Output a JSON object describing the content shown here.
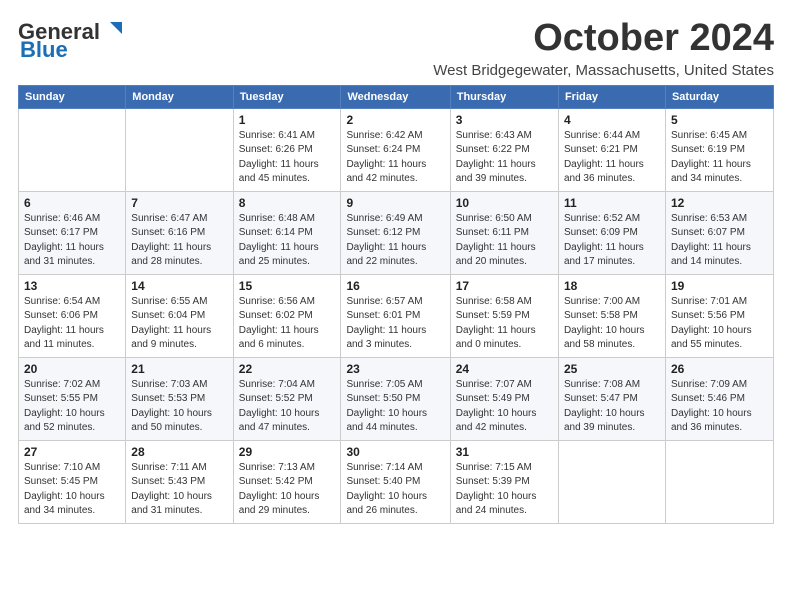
{
  "logo": {
    "general": "General",
    "blue": "Blue"
  },
  "title": "October 2024",
  "location": "West Bridgegewater, Massachusetts, United States",
  "days_of_week": [
    "Sunday",
    "Monday",
    "Tuesday",
    "Wednesday",
    "Thursday",
    "Friday",
    "Saturday"
  ],
  "weeks": [
    [
      {
        "day": "",
        "info": ""
      },
      {
        "day": "",
        "info": ""
      },
      {
        "day": "1",
        "info": "Sunrise: 6:41 AM\nSunset: 6:26 PM\nDaylight: 11 hours and 45 minutes."
      },
      {
        "day": "2",
        "info": "Sunrise: 6:42 AM\nSunset: 6:24 PM\nDaylight: 11 hours and 42 minutes."
      },
      {
        "day": "3",
        "info": "Sunrise: 6:43 AM\nSunset: 6:22 PM\nDaylight: 11 hours and 39 minutes."
      },
      {
        "day": "4",
        "info": "Sunrise: 6:44 AM\nSunset: 6:21 PM\nDaylight: 11 hours and 36 minutes."
      },
      {
        "day": "5",
        "info": "Sunrise: 6:45 AM\nSunset: 6:19 PM\nDaylight: 11 hours and 34 minutes."
      }
    ],
    [
      {
        "day": "6",
        "info": "Sunrise: 6:46 AM\nSunset: 6:17 PM\nDaylight: 11 hours and 31 minutes."
      },
      {
        "day": "7",
        "info": "Sunrise: 6:47 AM\nSunset: 6:16 PM\nDaylight: 11 hours and 28 minutes."
      },
      {
        "day": "8",
        "info": "Sunrise: 6:48 AM\nSunset: 6:14 PM\nDaylight: 11 hours and 25 minutes."
      },
      {
        "day": "9",
        "info": "Sunrise: 6:49 AM\nSunset: 6:12 PM\nDaylight: 11 hours and 22 minutes."
      },
      {
        "day": "10",
        "info": "Sunrise: 6:50 AM\nSunset: 6:11 PM\nDaylight: 11 hours and 20 minutes."
      },
      {
        "day": "11",
        "info": "Sunrise: 6:52 AM\nSunset: 6:09 PM\nDaylight: 11 hours and 17 minutes."
      },
      {
        "day": "12",
        "info": "Sunrise: 6:53 AM\nSunset: 6:07 PM\nDaylight: 11 hours and 14 minutes."
      }
    ],
    [
      {
        "day": "13",
        "info": "Sunrise: 6:54 AM\nSunset: 6:06 PM\nDaylight: 11 hours and 11 minutes."
      },
      {
        "day": "14",
        "info": "Sunrise: 6:55 AM\nSunset: 6:04 PM\nDaylight: 11 hours and 9 minutes."
      },
      {
        "day": "15",
        "info": "Sunrise: 6:56 AM\nSunset: 6:02 PM\nDaylight: 11 hours and 6 minutes."
      },
      {
        "day": "16",
        "info": "Sunrise: 6:57 AM\nSunset: 6:01 PM\nDaylight: 11 hours and 3 minutes."
      },
      {
        "day": "17",
        "info": "Sunrise: 6:58 AM\nSunset: 5:59 PM\nDaylight: 11 hours and 0 minutes."
      },
      {
        "day": "18",
        "info": "Sunrise: 7:00 AM\nSunset: 5:58 PM\nDaylight: 10 hours and 58 minutes."
      },
      {
        "day": "19",
        "info": "Sunrise: 7:01 AM\nSunset: 5:56 PM\nDaylight: 10 hours and 55 minutes."
      }
    ],
    [
      {
        "day": "20",
        "info": "Sunrise: 7:02 AM\nSunset: 5:55 PM\nDaylight: 10 hours and 52 minutes."
      },
      {
        "day": "21",
        "info": "Sunrise: 7:03 AM\nSunset: 5:53 PM\nDaylight: 10 hours and 50 minutes."
      },
      {
        "day": "22",
        "info": "Sunrise: 7:04 AM\nSunset: 5:52 PM\nDaylight: 10 hours and 47 minutes."
      },
      {
        "day": "23",
        "info": "Sunrise: 7:05 AM\nSunset: 5:50 PM\nDaylight: 10 hours and 44 minutes."
      },
      {
        "day": "24",
        "info": "Sunrise: 7:07 AM\nSunset: 5:49 PM\nDaylight: 10 hours and 42 minutes."
      },
      {
        "day": "25",
        "info": "Sunrise: 7:08 AM\nSunset: 5:47 PM\nDaylight: 10 hours and 39 minutes."
      },
      {
        "day": "26",
        "info": "Sunrise: 7:09 AM\nSunset: 5:46 PM\nDaylight: 10 hours and 36 minutes."
      }
    ],
    [
      {
        "day": "27",
        "info": "Sunrise: 7:10 AM\nSunset: 5:45 PM\nDaylight: 10 hours and 34 minutes."
      },
      {
        "day": "28",
        "info": "Sunrise: 7:11 AM\nSunset: 5:43 PM\nDaylight: 10 hours and 31 minutes."
      },
      {
        "day": "29",
        "info": "Sunrise: 7:13 AM\nSunset: 5:42 PM\nDaylight: 10 hours and 29 minutes."
      },
      {
        "day": "30",
        "info": "Sunrise: 7:14 AM\nSunset: 5:40 PM\nDaylight: 10 hours and 26 minutes."
      },
      {
        "day": "31",
        "info": "Sunrise: 7:15 AM\nSunset: 5:39 PM\nDaylight: 10 hours and 24 minutes."
      },
      {
        "day": "",
        "info": ""
      },
      {
        "day": "",
        "info": ""
      }
    ]
  ]
}
